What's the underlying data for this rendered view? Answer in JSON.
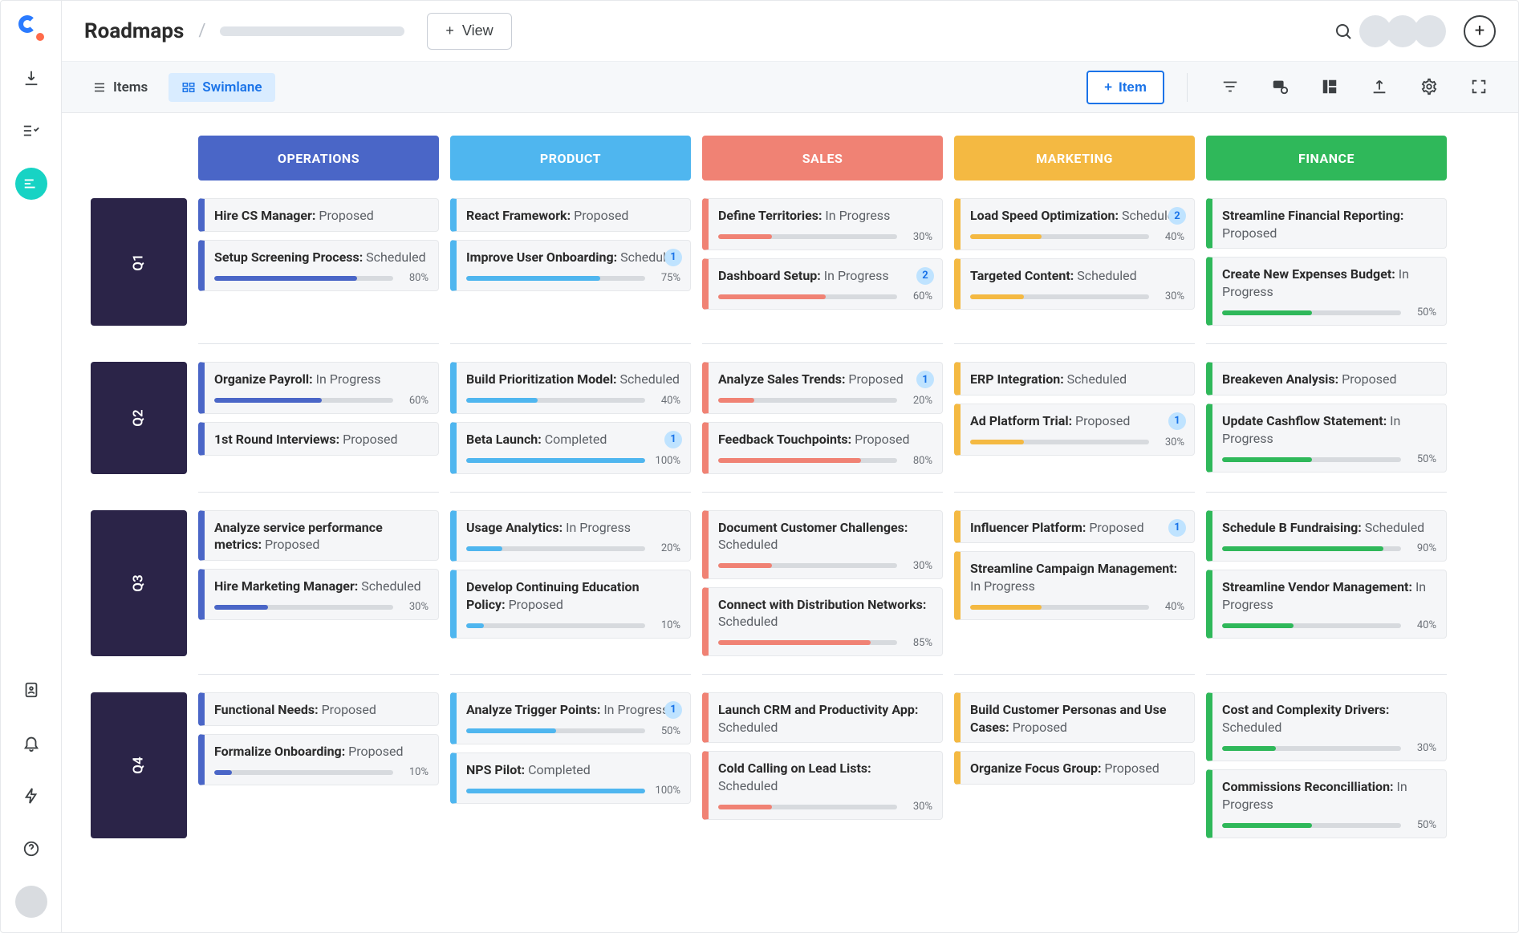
{
  "header": {
    "title": "Roadmaps",
    "view_button": "View",
    "plus": "+"
  },
  "toolbar": {
    "tab_items": "Items",
    "tab_swimlane": "Swimlane",
    "add_item": "Item",
    "add_plus": "+"
  },
  "columns": [
    {
      "id": "operations",
      "label": "OPERATIONS",
      "color": "#4a66c7",
      "fill": "#4a66c7"
    },
    {
      "id": "product",
      "label": "PRODUCT",
      "color": "#4fb6ef",
      "fill": "#4fb6ef"
    },
    {
      "id": "sales",
      "label": "SALES",
      "color": "#f08274",
      "fill": "#f08274"
    },
    {
      "id": "marketing",
      "label": "MARKETING",
      "color": "#f4b942",
      "fill": "#f4b942"
    },
    {
      "id": "finance",
      "label": "FINANCE",
      "color": "#2fb85a",
      "fill": "#2fb85a"
    }
  ],
  "rows": [
    "Q1",
    "Q2",
    "Q3",
    "Q4"
  ],
  "cells": {
    "Q1": {
      "operations": [
        {
          "title": "Hire CS Manager:",
          "status": "Proposed"
        },
        {
          "title": "Setup Screening Process:",
          "status": "Scheduled",
          "progress": 80
        }
      ],
      "product": [
        {
          "title": "React Framework:",
          "status": "Proposed"
        },
        {
          "title": "Improve User Onboarding:",
          "status": "Scheduled",
          "badge": 1,
          "progress": 75
        }
      ],
      "sales": [
        {
          "title": "Define Territories:",
          "status": "In Progress",
          "progress": 30
        },
        {
          "title": "Dashboard Setup:",
          "status": "In Progress",
          "badge": 2,
          "progress": 60
        }
      ],
      "marketing": [
        {
          "title": "Load Speed Optimization:",
          "status": "Scheduled",
          "badge": 2,
          "progress": 40
        },
        {
          "title": "Targeted Content:",
          "status": "Scheduled",
          "progress": 30
        }
      ],
      "finance": [
        {
          "title": "Streamline Financial Reporting:",
          "status": "Proposed"
        },
        {
          "title": "Create New Expenses Budget:",
          "status": "In Progress",
          "progress": 50
        }
      ]
    },
    "Q2": {
      "operations": [
        {
          "title": "Organize Payroll:",
          "status": "In Progress",
          "progress": 60
        },
        {
          "title": "1st Round Interviews:",
          "status": "Proposed"
        }
      ],
      "product": [
        {
          "title": "Build Prioritization Model:",
          "status": "Scheduled",
          "progress": 40
        },
        {
          "title": "Beta Launch:",
          "status": "Completed",
          "badge": 1,
          "progress": 100
        }
      ],
      "sales": [
        {
          "title": "Analyze Sales Trends:",
          "status": "Proposed",
          "badge": 1,
          "progress": 20
        },
        {
          "title": "Feedback Touchpoints:",
          "status": "Proposed",
          "progress": 80
        }
      ],
      "marketing": [
        {
          "title": "ERP Integration:",
          "status": "Scheduled"
        },
        {
          "title": "Ad Platform Trial:",
          "status": "Proposed",
          "badge": 1,
          "progress": 30
        }
      ],
      "finance": [
        {
          "title": "Breakeven Analysis:",
          "status": "Proposed"
        },
        {
          "title": "Update Cashflow Statement:",
          "status": "In Progress",
          "progress": 50
        }
      ]
    },
    "Q3": {
      "operations": [
        {
          "title": "Analyze service performance metrics:",
          "status": "Proposed"
        },
        {
          "title": "Hire Marketing Manager:",
          "status": "Scheduled",
          "progress": 30
        }
      ],
      "product": [
        {
          "title": "Usage Analytics:",
          "status": "In Progress",
          "progress": 20
        },
        {
          "title": "Develop Continuing Education Policy:",
          "status": "Proposed",
          "progress": 10
        }
      ],
      "sales": [
        {
          "title": "Document Customer Challenges:",
          "status": "Scheduled",
          "progress": 30
        },
        {
          "title": "Connect with Distribution Networks:",
          "status": "Scheduled",
          "progress": 85
        }
      ],
      "marketing": [
        {
          "title": "Influencer Platform:",
          "status": "Proposed",
          "badge": 1
        },
        {
          "title": "Streamline Campaign Management:",
          "status": "In Progress",
          "progress": 40
        }
      ],
      "finance": [
        {
          "title": "Schedule B Fundraising:",
          "status": "Scheduled",
          "progress": 90
        },
        {
          "title": "Streamline Vendor Management:",
          "status": "In Progress",
          "progress": 40
        }
      ]
    },
    "Q4": {
      "operations": [
        {
          "title": "Functional Needs:",
          "status": "Proposed"
        },
        {
          "title": "Formalize Onboarding:",
          "status": "Proposed",
          "progress": 10
        }
      ],
      "product": [
        {
          "title": "Analyze Trigger Points:",
          "status": "In Progress",
          "badge": 1,
          "progress": 50
        },
        {
          "title": "NPS Pilot:",
          "status": "Completed",
          "progress": 100
        }
      ],
      "sales": [
        {
          "title": "Launch CRM and Productivity App:",
          "status": "Scheduled"
        },
        {
          "title": "Cold Calling on Lead Lists:",
          "status": "Scheduled",
          "progress": 30
        }
      ],
      "marketing": [
        {
          "title": "Build Customer Personas and Use Cases:",
          "status": "Proposed"
        },
        {
          "title": "Organize Focus Group:",
          "status": "Proposed"
        }
      ],
      "finance": [
        {
          "title": "Cost and Complexity Drivers:",
          "status": "Scheduled",
          "progress": 30
        },
        {
          "title": "Commissions Reconcilliation:",
          "status": "In Progress",
          "progress": 50
        }
      ]
    }
  }
}
